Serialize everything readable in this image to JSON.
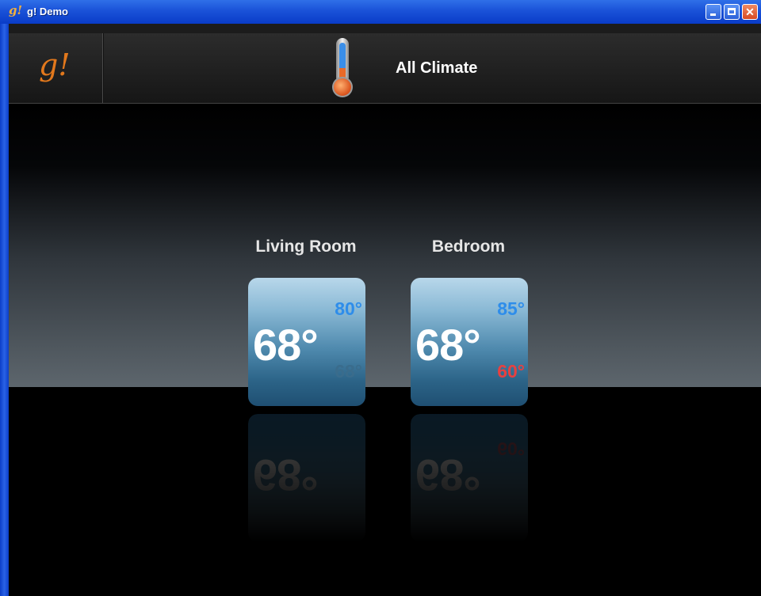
{
  "window": {
    "title": "g! Demo",
    "icon": "g!"
  },
  "header": {
    "logo": "g!",
    "title": "All Climate",
    "icon": "thermometer-icon"
  },
  "rooms": [
    {
      "name": "Living Room",
      "current": "68°",
      "cool_setpoint": "80°",
      "heat_setpoint": "68°"
    },
    {
      "name": "Bedroom",
      "current": "68°",
      "cool_setpoint": "85°",
      "heat_setpoint": "60°"
    }
  ],
  "colors": {
    "cool": "#2e8dea",
    "heat": "#e84040",
    "logo": "#e2781c"
  }
}
